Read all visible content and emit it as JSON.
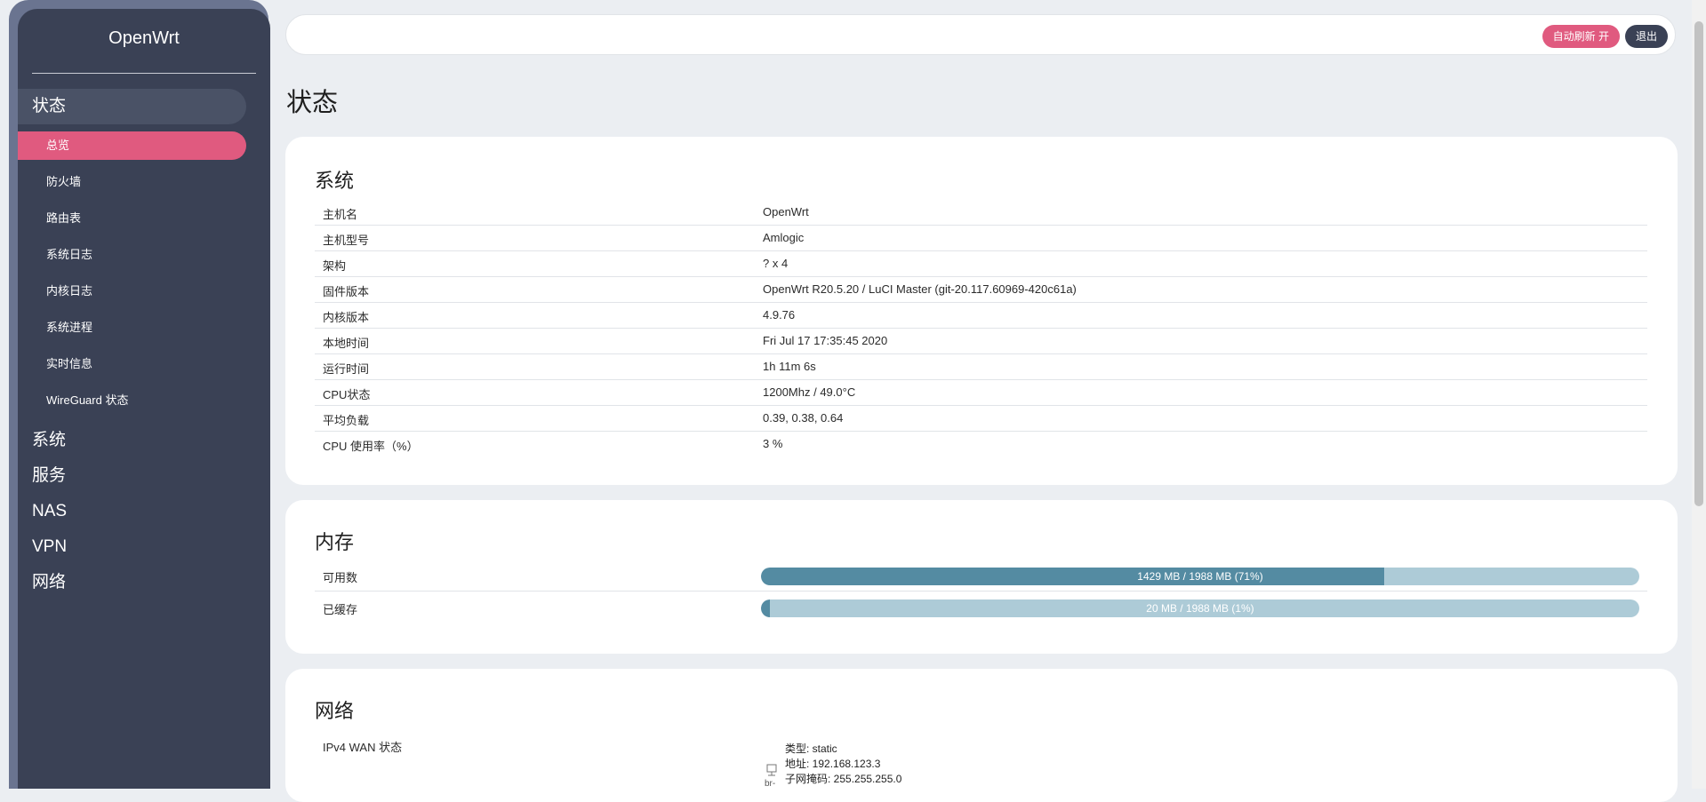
{
  "sidebar": {
    "brand": "OpenWrt",
    "status_category": "状态",
    "status_items": [
      {
        "label": "总览",
        "active": true
      },
      {
        "label": "防火墙"
      },
      {
        "label": "路由表"
      },
      {
        "label": "系统日志"
      },
      {
        "label": "内核日志"
      },
      {
        "label": "系统进程"
      },
      {
        "label": "实时信息"
      },
      {
        "label": "WireGuard 状态"
      }
    ],
    "categories": [
      "系统",
      "服务",
      "NAS",
      "VPN",
      "网络"
    ]
  },
  "header": {
    "auto_refresh_label": "自动刷新 开",
    "logout_label": "退出"
  },
  "page": {
    "title": "状态"
  },
  "system": {
    "title": "系统",
    "rows": [
      {
        "label": "主机名",
        "value": "OpenWrt"
      },
      {
        "label": "主机型号",
        "value": "Amlogic"
      },
      {
        "label": "架构",
        "value": "? x 4"
      },
      {
        "label": "固件版本",
        "value": "OpenWrt R20.5.20 / LuCI Master (git-20.117.60969-420c61a)"
      },
      {
        "label": "内核版本",
        "value": "4.9.76"
      },
      {
        "label": "本地时间",
        "value": "Fri Jul 17 17:35:45 2020"
      },
      {
        "label": "运行时间",
        "value": "1h 11m 6s"
      },
      {
        "label": "CPU状态",
        "value": "1200Mhz / 49.0°C"
      },
      {
        "label": "平均负载",
        "value": "0.39, 0.38, 0.64"
      },
      {
        "label": "CPU 使用率（%）",
        "value": "3 %"
      }
    ]
  },
  "memory": {
    "title": "内存",
    "rows": [
      {
        "label": "可用数",
        "text": "1429 MB / 1988 MB (71%)",
        "percent": 71
      },
      {
        "label": "已缓存",
        "text": "20 MB / 1988 MB (1%)",
        "percent": 1
      }
    ]
  },
  "network": {
    "title": "网络",
    "ipv4_wan_label": "IPv4 WAN 状态",
    "icon_text": "br-",
    "details": [
      "类型: static",
      "地址: 192.168.123.3",
      "子网掩码: 255.255.255.0"
    ]
  },
  "colors": {
    "accent": "#e05a7f",
    "sidebar": "#3a4155",
    "bar_fill": "#548ba2",
    "bar_track": "#adcbd7"
  }
}
